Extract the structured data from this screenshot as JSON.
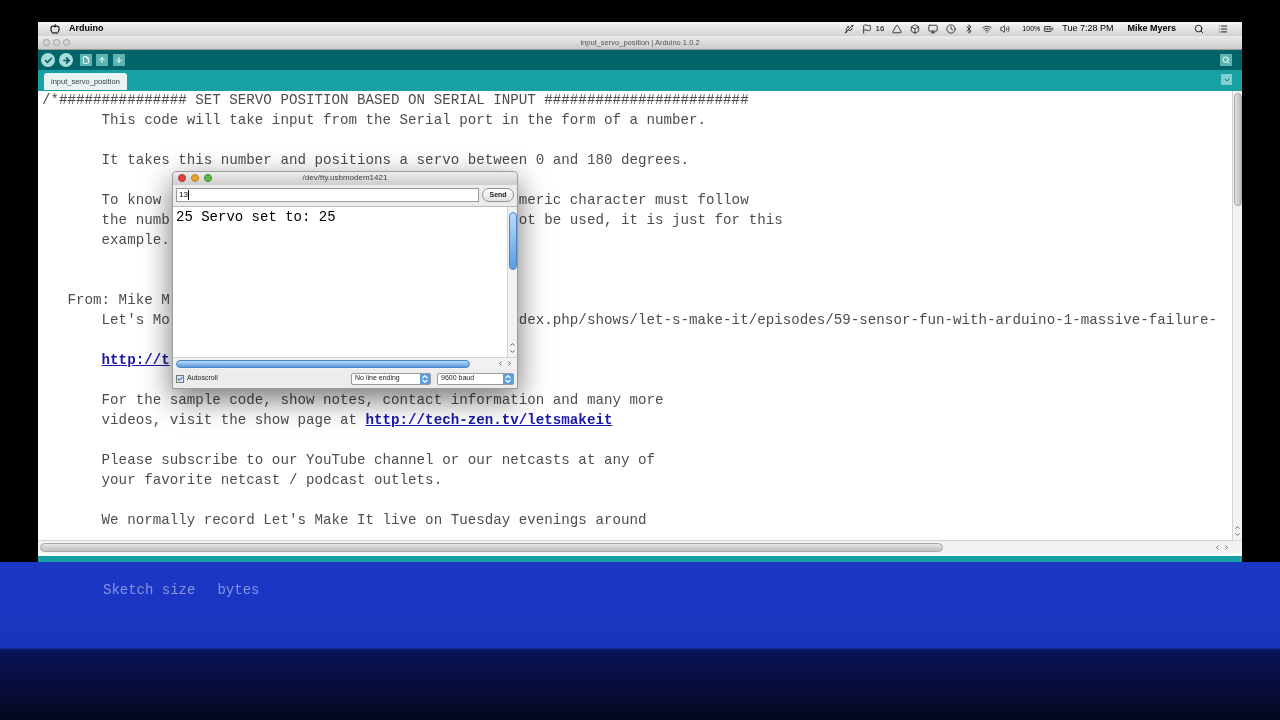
{
  "menu_bar": {
    "app_name": "Arduino",
    "status_count": "16",
    "battery": "100%",
    "clock": "Tue 7:28 PM",
    "user": "Mike Myers"
  },
  "window": {
    "title": "input_servo_position | Arduino 1.0.2"
  },
  "tabs": [
    {
      "label": "input_servo_position",
      "selected": true
    }
  ],
  "editor": {
    "lines": [
      {
        "kind": "header",
        "text": "/*############### SET SERVO POSITION BASED ON SERIAL INPUT ########################"
      },
      {
        "kind": "body",
        "text": "This code will take input from the Serial port in the form of a number."
      },
      {
        "kind": "blank"
      },
      {
        "kind": "body",
        "text": "It takes this number and positions a servo between 0 and 180 degrees."
      },
      {
        "kind": "blank"
      },
      {
        "kind": "body",
        "text": "To know",
        "text_right": "meric character must follow"
      },
      {
        "kind": "body",
        "text": "the numb",
        "text_right": "ot be used, it is just for this"
      },
      {
        "kind": "body",
        "text": "example."
      },
      {
        "kind": "blank"
      },
      {
        "kind": "blank"
      },
      {
        "kind": "attribution",
        "text": "From: Mike M"
      },
      {
        "kind": "body",
        "text": "Let's Mo",
        "text_right": "dex.php/shows/let-s-make-it/episodes/59-sensor-fun-with-arduino-1-massive-failure-"
      },
      {
        "kind": "blank"
      },
      {
        "kind": "body",
        "link": "http://t"
      },
      {
        "kind": "blank"
      },
      {
        "kind": "body",
        "text": "For the sample code, show notes, contact information and many more"
      },
      {
        "kind": "body",
        "text": "videos, visit the show page at",
        "link": "http://tech-zen.tv/letsmakeit"
      },
      {
        "kind": "blank"
      },
      {
        "kind": "body",
        "text": "Please subscribe to our YouTube channel or our netcasts at any of"
      },
      {
        "kind": "body",
        "text": "your favorite netcast / podcast outlets."
      },
      {
        "kind": "blank"
      },
      {
        "kind": "body",
        "text": "We normally record Let's Make It live on Tuesday evenings around"
      }
    ]
  },
  "serial_monitor": {
    "title": "/dev/tty.usbmodem1421",
    "input": {
      "value": "13"
    },
    "send_button": "Send",
    "output": [
      "25 Servo set to: 25"
    ],
    "autoscroll": {
      "label": "Autoscroll",
      "checked": true
    },
    "line_ending": "No line ending",
    "baud_rate": "9600 baud"
  },
  "console": {
    "fragments": [
      "Sketch size",
      "bytes"
    ]
  }
}
